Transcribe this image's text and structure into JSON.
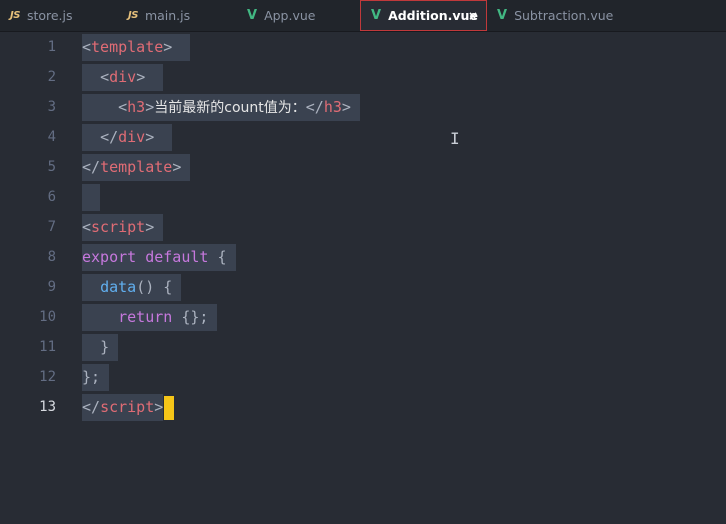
{
  "tabs": [
    {
      "icon": "JS",
      "label": "store.js"
    },
    {
      "icon": "JS",
      "label": "main.js"
    },
    {
      "icon": "V",
      "label": "App.vue"
    },
    {
      "icon": "V",
      "label": "Addition.vue",
      "close": "×"
    },
    {
      "icon": "V",
      "label": "Subtraction.vue"
    }
  ],
  "line_numbers": [
    "1",
    "2",
    "3",
    "4",
    "5",
    "6",
    "7",
    "8",
    "9",
    "10",
    "11",
    "12",
    "13"
  ],
  "code": {
    "l1": {
      "open": "<",
      "name": "template",
      "close": ">"
    },
    "l2": {
      "open": "<",
      "name": "div",
      "close": ">"
    },
    "l3": {
      "open": "<",
      "name": "h3",
      "close": ">",
      "text": "当前最新的count值为：",
      "end_open": "</",
      "end_name": "h3",
      "end_close": ">"
    },
    "l4": {
      "open": "</",
      "name": "div",
      "close": ">"
    },
    "l5": {
      "open": "</",
      "name": "template",
      "close": ">"
    },
    "l7": {
      "open": "<",
      "name": "script",
      "close": ">"
    },
    "l8": {
      "kw1": "export",
      "kw2": "default",
      "brace": "{"
    },
    "l9": {
      "fn": "data",
      "paren": "()",
      "brace": "{"
    },
    "l10": {
      "kw": "return",
      "rest": "{};"
    },
    "l11": {
      "brace": "}"
    },
    "l12": {
      "brace": "};"
    },
    "l13": {
      "open": "</",
      "name": "script",
      "close": ">"
    }
  },
  "colors": {
    "background": "#282c34",
    "tag": "#e06c75",
    "keyword": "#c678dd",
    "function": "#61afef",
    "vue_icon": "#42b883",
    "js_icon": "#e6c07b",
    "cursor": "#f5c518",
    "active_tab_border": "#c0393b"
  }
}
